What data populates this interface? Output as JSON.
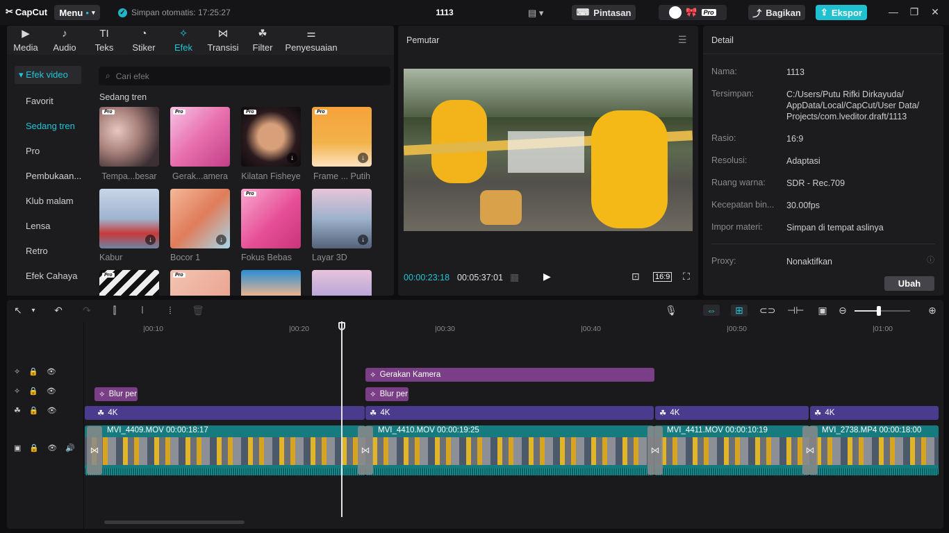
{
  "app": {
    "logo": "CapCut",
    "menu": "Menu",
    "autosave": "Simpan otomatis: 17:25:27",
    "project": "1113",
    "shortcuts": "Pintasan",
    "share": "Bagikan",
    "export": "Ekspor",
    "pro_badge": "Pro"
  },
  "tabs": [
    {
      "label": "Media",
      "icon": "▶"
    },
    {
      "label": "Audio",
      "icon": "♪"
    },
    {
      "label": "Teks",
      "icon": "TI"
    },
    {
      "label": "Stiker",
      "icon": "◔"
    },
    {
      "label": "Efek",
      "icon": "✧"
    },
    {
      "label": "Transisi",
      "icon": "⋈"
    },
    {
      "label": "Filter",
      "icon": "☘"
    },
    {
      "label": "Penyesuaian",
      "icon": "⚌"
    }
  ],
  "categories": {
    "root": "Efek video",
    "items": [
      "Favorit",
      "Sedang tren",
      "Pro",
      "Pembukaan...",
      "Klub malam",
      "Lensa",
      "Retro",
      "Efek Cahaya"
    ]
  },
  "search_placeholder": "Cari efek",
  "section_title": "Sedang tren",
  "effects": [
    {
      "label": "Tempa...besar",
      "pro": true,
      "dl": false
    },
    {
      "label": "Gerak...amera",
      "pro": true,
      "dl": false
    },
    {
      "label": "Kilatan Fisheye",
      "pro": true,
      "dl": true
    },
    {
      "label": "Frame ... Putih",
      "pro": true,
      "dl": true
    },
    {
      "label": "Kabur",
      "pro": false,
      "dl": true
    },
    {
      "label": "Bocor 1",
      "pro": false,
      "dl": true
    },
    {
      "label": "Fokus Bebas",
      "pro": true,
      "dl": false
    },
    {
      "label": "Layar 3D",
      "pro": false,
      "dl": true
    }
  ],
  "player": {
    "title": "Pemutar",
    "current": "00:00:23:18",
    "total": "00:05:37:01",
    "ratio": "16:9"
  },
  "detail": {
    "title": "Detail",
    "rows": [
      {
        "label": "Nama:",
        "value": "1113"
      },
      {
        "label": "Tersimpan:",
        "value": "C:/Users/Putu Rifki Dirkayuda/ AppData/Local/CapCut/User Data/ Projects/com.lveditor.draft/1113"
      },
      {
        "label": "Rasio:",
        "value": "16:9"
      },
      {
        "label": "Resolusi:",
        "value": "Adaptasi"
      },
      {
        "label": "Ruang warna:",
        "value": "SDR - Rec.709"
      },
      {
        "label": "Kecepatan bin...",
        "value": "30.00fps"
      },
      {
        "label": "Impor materi:",
        "value": "Simpan di tempat aslinya"
      },
      {
        "label": "Proxy:",
        "value": "Nonaktifkan"
      }
    ],
    "button": "Ubah"
  },
  "ruler": [
    "00:10",
    "00:20",
    "00:30",
    "00:40",
    "00:50",
    "01:00"
  ],
  "clips": {
    "fx_top": "Gerakan Kamera",
    "fx_blur1": "Blur per",
    "fx_blur2": "Blur per",
    "filter1": "4K",
    "filter2": "4K",
    "filter3": "4K",
    "filter4": "4K",
    "v1": "MVI_4409.MOV   00:00:18:17",
    "v2": "MVI_4410.MOV   00:00:19:25",
    "v3": "MVI_4411.MOV   00:00:10:19",
    "v4": "MVI_2738.MP4   00:00:18:00"
  },
  "colors": {
    "accent": "#1fc6d6",
    "effect_clip": "#7a3e86",
    "filter_clip": "#4a3b8e",
    "video_clip": "#167b7f"
  }
}
